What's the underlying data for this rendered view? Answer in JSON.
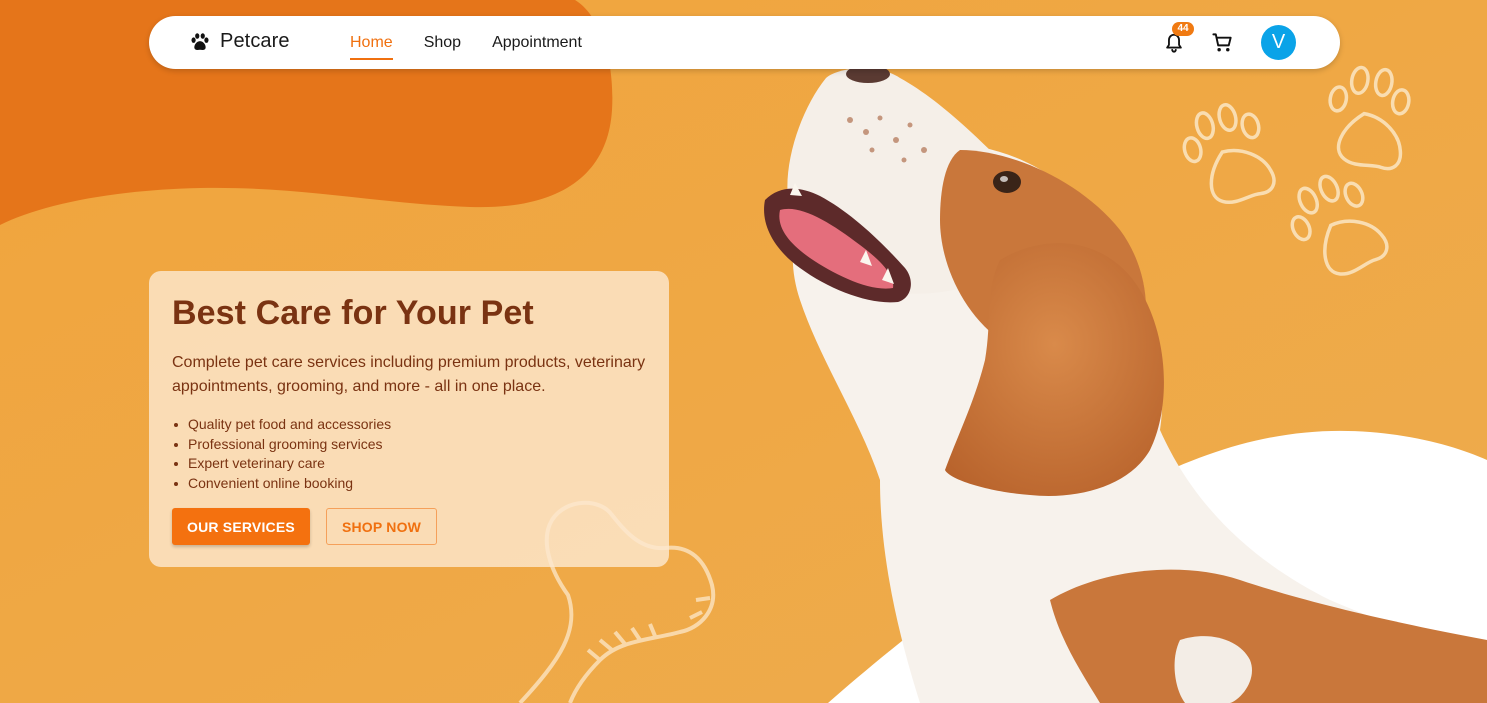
{
  "theme": {
    "accent": "#f0700f",
    "background": "#efa845",
    "blob": "#e5751a",
    "heading_color": "#7a3312",
    "avatar_color": "#0aa3e8"
  },
  "navbar": {
    "brand": {
      "icon": "paw-icon",
      "name": "Petcare"
    },
    "links": [
      {
        "label": "Home",
        "active": true
      },
      {
        "label": "Shop",
        "active": false
      },
      {
        "label": "Appointment",
        "active": false
      }
    ],
    "notifications": {
      "icon": "bell-icon",
      "count": "44"
    },
    "cart": {
      "icon": "cart-icon"
    },
    "avatar": {
      "initial": "V"
    }
  },
  "hero": {
    "title": "Best Care for Your Pet",
    "description": "Complete pet care services including premium products, veterinary appointments, grooming, and more - all in one place.",
    "features": [
      "Quality pet food and accessories",
      "Professional grooming services",
      "Expert veterinary care",
      "Convenient online booking"
    ],
    "primary_button": "OUR SERVICES",
    "secondary_button": "SHOP NOW"
  },
  "decorations": {
    "image": "beagle-dog-photo",
    "paw_prints": "paw-print-outline-icons",
    "bone": "bone-outline-icon"
  }
}
